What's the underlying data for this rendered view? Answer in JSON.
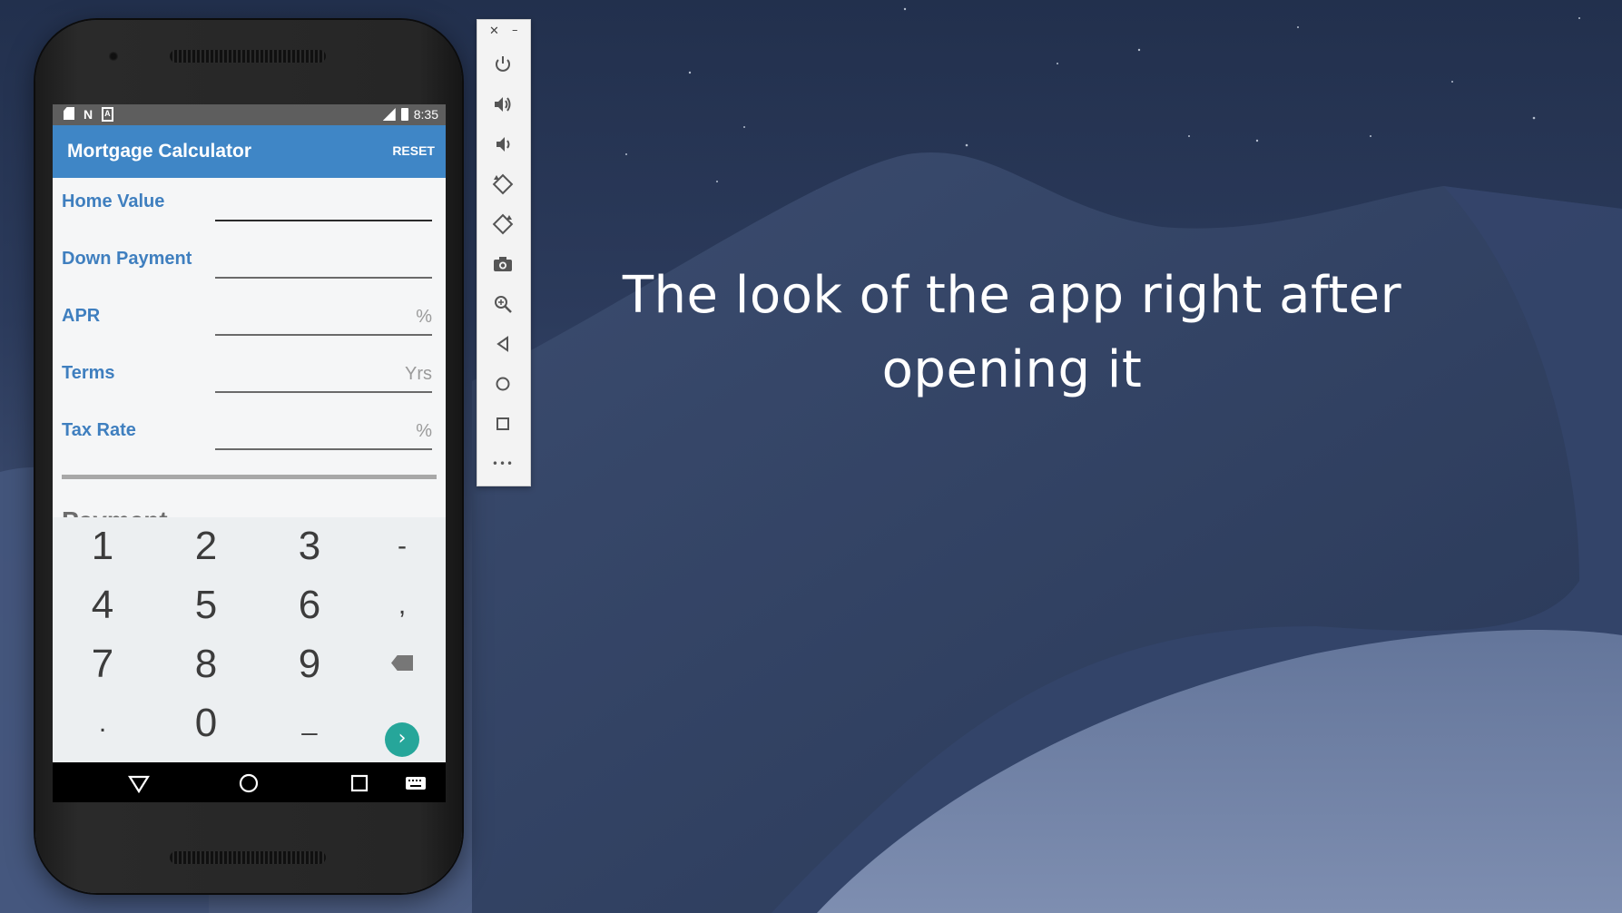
{
  "caption": {
    "line1": "The look of the app right after",
    "line2": "opening it"
  },
  "status_bar": {
    "time": "8:35",
    "icons": [
      "sd-card-icon",
      "n-icon",
      "a-icon",
      "signal-icon",
      "battery-icon"
    ]
  },
  "app_bar": {
    "title": "Mortgage Calculator",
    "reset_label": "RESET",
    "color": "#3f86c6"
  },
  "form": {
    "fields": [
      {
        "label": "Home Value",
        "value": "",
        "suffix": ""
      },
      {
        "label": "Down Payment",
        "value": "",
        "suffix": ""
      },
      {
        "label": "APR",
        "value": "",
        "suffix": "%"
      },
      {
        "label": "Terms",
        "value": "",
        "suffix": "Yrs"
      },
      {
        "label": "Tax Rate",
        "value": "",
        "suffix": "%"
      }
    ],
    "payment_heading": "Payment"
  },
  "keypad": {
    "keys": [
      "1",
      "2",
      "3",
      "-",
      "4",
      "5",
      "6",
      ",",
      "7",
      "8",
      "9",
      ".",
      "0",
      "_"
    ],
    "go_color": "#26a69a"
  },
  "toolbar": {
    "buttons": [
      "power-icon",
      "volume-up-icon",
      "volume-down-icon",
      "rotate-left-icon",
      "rotate-right-icon",
      "camera-icon",
      "zoom-icon",
      "back-icon",
      "home-icon",
      "overview-icon",
      "more-icon"
    ],
    "more_label": "•••"
  },
  "nav_bar": {
    "buttons": [
      "back-triangle-icon",
      "home-circle-icon",
      "recents-square-icon",
      "keyboard-icon"
    ]
  }
}
